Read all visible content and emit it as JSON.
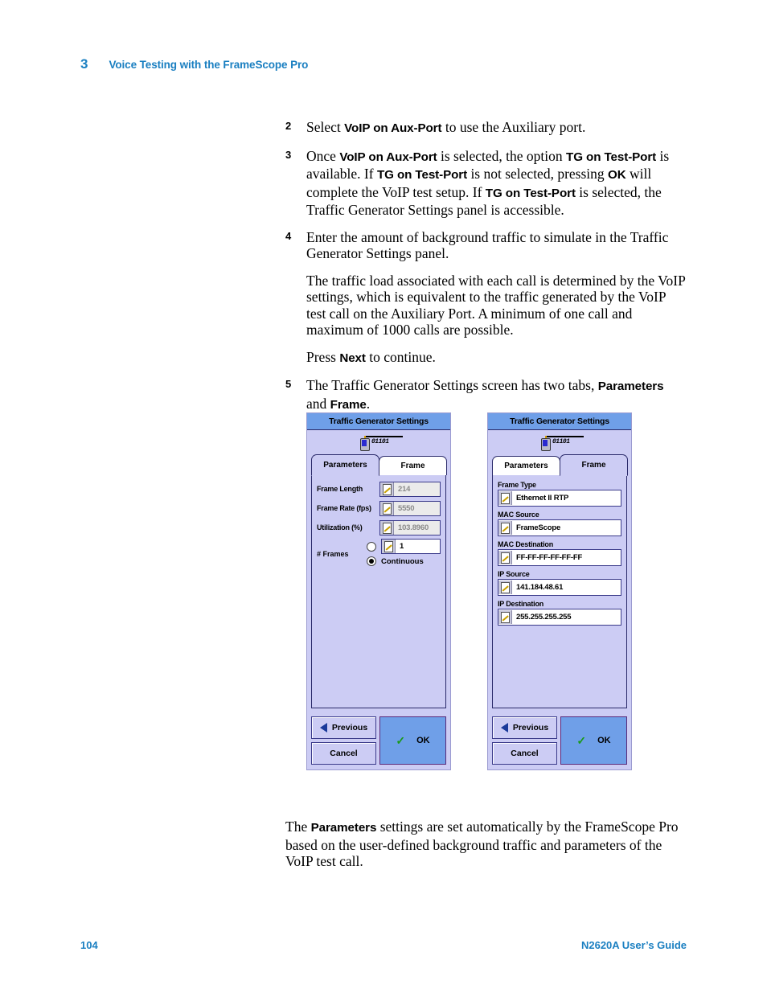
{
  "header": {
    "chapter_number": "3",
    "chapter_title": "Voice Testing with the FrameScope Pro"
  },
  "steps": {
    "s2": {
      "num": "2",
      "t1": "Select ",
      "b1": "VoIP on Aux-Port",
      "t2": " to use the Auxiliary port."
    },
    "s3": {
      "num": "3",
      "t1": "Once ",
      "b1": "VoIP on Aux-Port",
      "t2": " is selected, the option ",
      "b2": "TG on Test-Port",
      "t3": " is available. If ",
      "b3": "TG on Test-Port",
      "t4": " is not selected, pressing ",
      "b4": "OK",
      "t5": " will complete the VoIP test setup. If ",
      "b5": "TG on Test-Port",
      "t6": " is selected, the Traffic Generator Settings panel is accessible."
    },
    "s4": {
      "num": "4",
      "t1": "Enter the amount of background traffic to simulate in the Traffic Generator Settings panel."
    },
    "p_traffic_load": "The traffic load associated with each call is determined by the VoIP settings, which is equivalent to the traffic generated by the VoIP test call on the Auxiliary Port. A minimum of one call and maximum of 1000 calls are possible.",
    "p_press_next": {
      "t1": "Press ",
      "b1": "Next",
      "t2": " to continue."
    },
    "s5": {
      "num": "5",
      "t1": "The Traffic Generator Settings screen has two tabs, ",
      "b1": "Parameters",
      "t2": " and ",
      "b2": "Frame",
      "t3": "."
    }
  },
  "closing": {
    "t1": "The ",
    "b1": "Parameters",
    "t2": " settings are set automatically by the FrameScope Pro based on the user-defined background traffic and parameters of the VoIP test call."
  },
  "device_left": {
    "title": "Traffic Generator Settings",
    "connection_digits": "01101",
    "tabs": [
      {
        "label": "Parameters",
        "active": true
      },
      {
        "label": "Frame",
        "active": false
      }
    ],
    "tab_parameters_label": "Parameters",
    "tab_frame_label": "Frame",
    "fields": [
      {
        "label": "Frame Length",
        "value": "214"
      },
      {
        "label": "Frame Rate (fps)",
        "value": "5550"
      },
      {
        "label": "Utilization (%)",
        "value": "103.8960"
      }
    ],
    "frames": {
      "label": "# Frames",
      "count_value": "1",
      "continuous_label": "Continuous",
      "count_selected": false,
      "continuous_selected": true
    },
    "buttons": {
      "previous": "Previous",
      "cancel": "Cancel",
      "ok": "OK"
    }
  },
  "device_right": {
    "title": "Traffic Generator Settings",
    "connection_digits": "01101",
    "tab_parameters_label": "Parameters",
    "tab_frame_label": "Frame",
    "fields": [
      {
        "label": "Frame Type",
        "value": "Ethernet II RTP"
      },
      {
        "label": "MAC Source",
        "value": "FrameScope"
      },
      {
        "label": "MAC Destination",
        "value": "FF-FF-FF-FF-FF-FF"
      },
      {
        "label": "IP Source",
        "value": "141.184.48.61"
      },
      {
        "label": "IP Destination",
        "value": "255.255.255.255"
      }
    ],
    "buttons": {
      "previous": "Previous",
      "cancel": "Cancel",
      "ok": "OK"
    }
  },
  "footer": {
    "page_number": "104",
    "guide_title": "N2620A User’s Guide"
  },
  "colors": {
    "accent_blue": "#1a7fc1",
    "titlebar_blue": "#6f9fe8",
    "panel_lavender": "#ccccf4",
    "check_green": "#1a9a1a"
  }
}
